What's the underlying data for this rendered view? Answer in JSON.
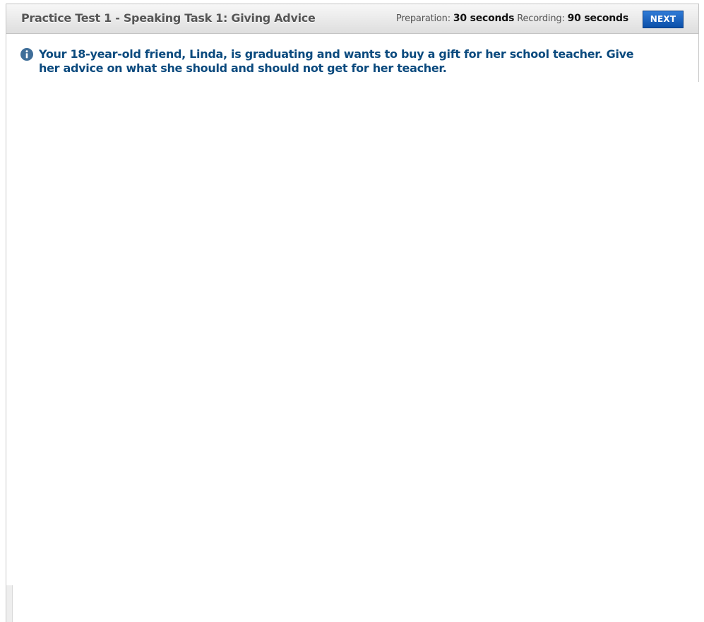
{
  "header": {
    "title": "Practice Test 1 - Speaking Task 1: Giving Advice",
    "preparation_label": "Preparation:",
    "preparation_value": "30 seconds",
    "recording_label": "Recording:",
    "recording_value": "90 seconds",
    "next_label": "NEXT"
  },
  "prompt": {
    "icon": "info-icon",
    "text": "Your 18-year-old friend, Linda, is graduating and wants to buy a gift for her school teacher. Give her advice on what she should and should not get for her teacher."
  },
  "colors": {
    "accent": "#0b4fa8",
    "prompt_text": "#0b4a7e",
    "header_text": "#555555"
  }
}
